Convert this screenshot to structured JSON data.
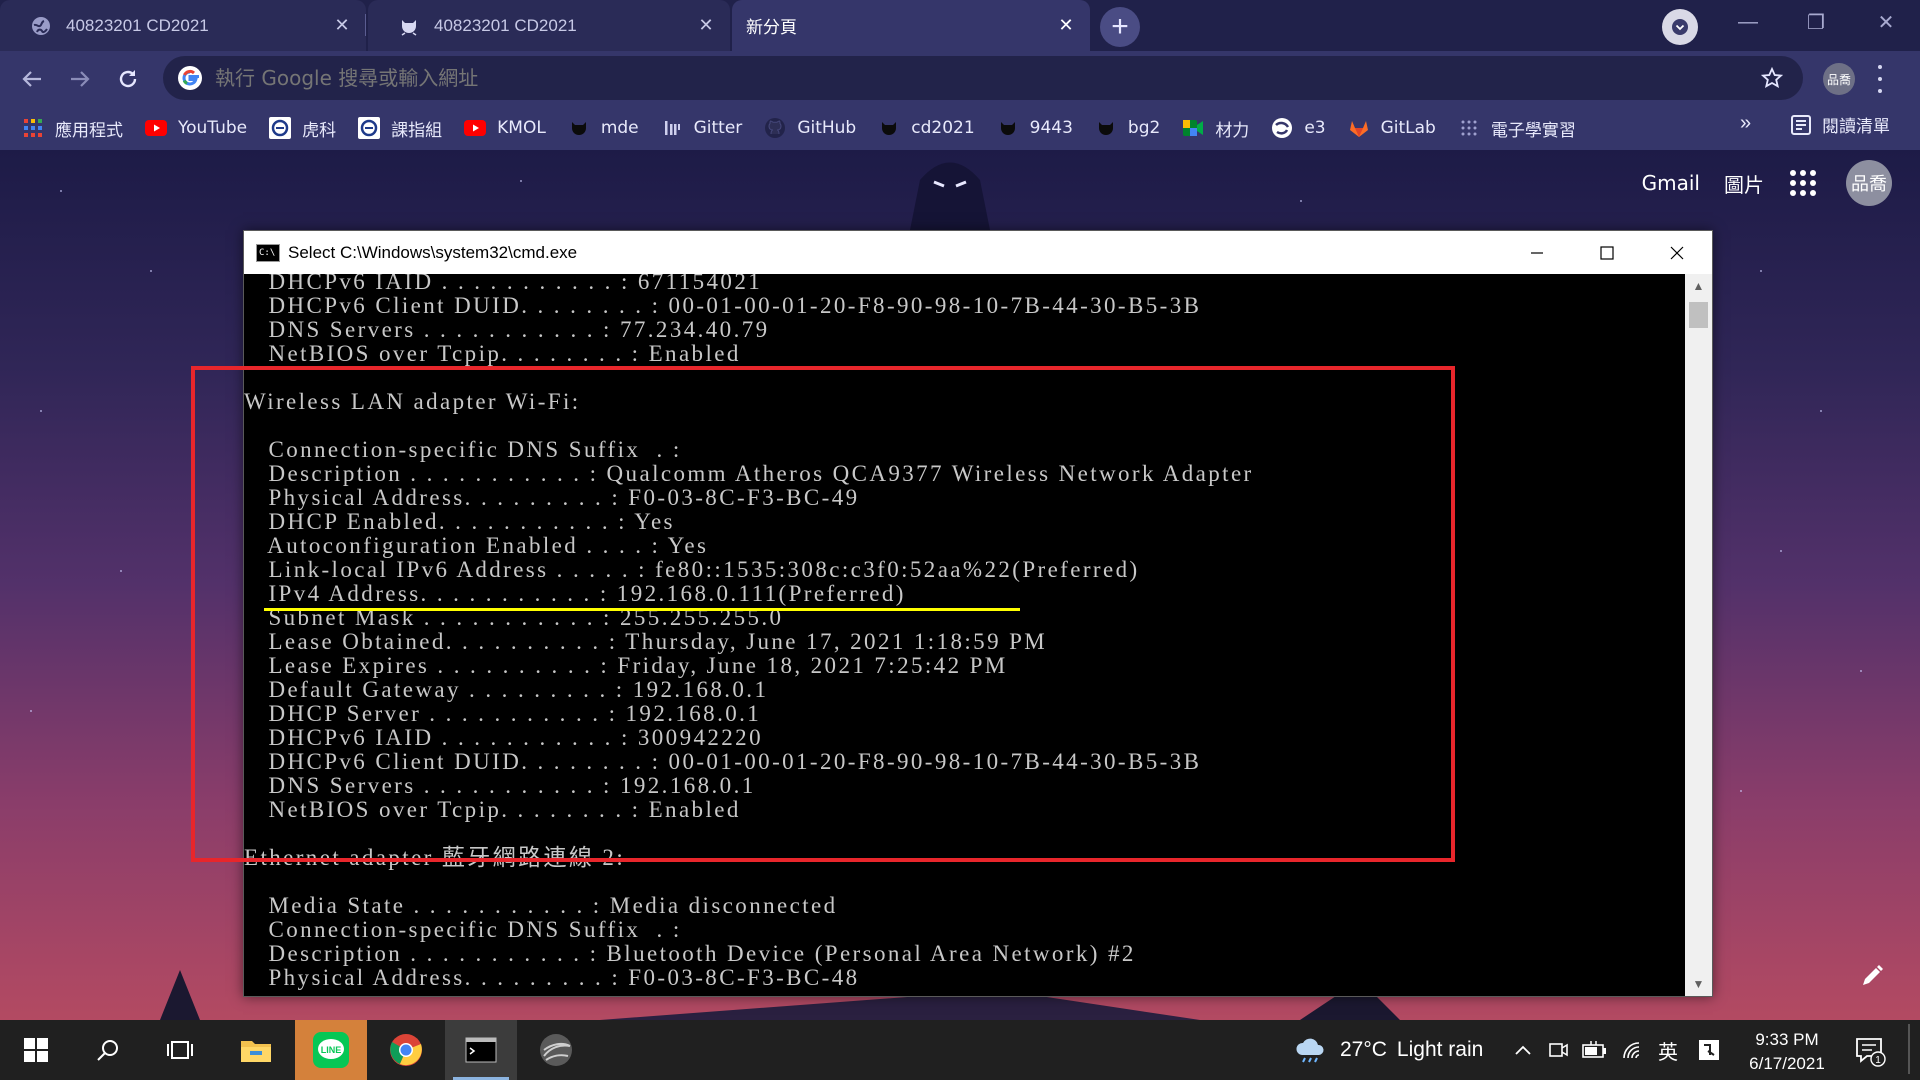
{
  "tabs": [
    {
      "title": "40823201 CD2021",
      "icon": "globe-icon",
      "active": false
    },
    {
      "title": "40823201 CD2021",
      "icon": "github-cat-icon",
      "active": false
    },
    {
      "title": "新分頁",
      "icon": "",
      "active": true
    }
  ],
  "toolbar": {
    "omnibox_placeholder": "執行 Google 搜尋或輸入網址",
    "profile_label": "品喬"
  },
  "bookmarks": [
    {
      "label": "應用程式",
      "icon": "apps-grid-icon"
    },
    {
      "label": "YouTube",
      "icon": "youtube-icon"
    },
    {
      "label": "虎科",
      "icon": "school-logo-icon"
    },
    {
      "label": "課指組",
      "icon": "school-logo-icon"
    },
    {
      "label": "KMOL",
      "icon": "youtube-icon"
    },
    {
      "label": "mde",
      "icon": "github-cat-icon"
    },
    {
      "label": "Gitter",
      "icon": "gitter-icon"
    },
    {
      "label": "GitHub",
      "icon": "github-icon"
    },
    {
      "label": "cd2021",
      "icon": "github-cat-icon"
    },
    {
      "label": "9443",
      "icon": "github-cat-icon"
    },
    {
      "label": "bg2",
      "icon": "github-cat-icon"
    },
    {
      "label": "材力",
      "icon": "meet-icon"
    },
    {
      "label": "e3",
      "icon": "e3-icon"
    },
    {
      "label": "GitLab",
      "icon": "gitlab-icon"
    },
    {
      "label": "電子學實習",
      "icon": "dots-icon"
    }
  ],
  "bookmarks_overflow": "»",
  "reading_list": "閱讀清單",
  "google_bar": {
    "gmail": "Gmail",
    "images": "圖片",
    "avatar": "品喬"
  },
  "cmd": {
    "title": "Select C:\\Windows\\system32\\cmd.exe",
    "lines": [
      "   DHCPv6 IAID . . . . . . . . . . . : 671154021",
      "   DHCPv6 Client DUID. . . . . . . . : 00-01-00-01-20-F8-90-98-10-7B-44-30-B5-3B",
      "   DNS Servers . . . . . . . . . . . : 77.234.40.79",
      "   NetBIOS over Tcpip. . . . . . . . : Enabled",
      "",
      "Wireless LAN adapter Wi-Fi:",
      "",
      "   Connection-specific DNS Suffix  . :",
      "   Description . . . . . . . . . . . : Qualcomm Atheros QCA9377 Wireless Network Adapter",
      "   Physical Address. . . . . . . . . : F0-03-8C-F3-BC-49",
      "   DHCP Enabled. . . . . . . . . . . : Yes",
      "   Autoconfiguration Enabled . . . . : Yes",
      "   Link-local IPv6 Address . . . . . : fe80::1535:308c:c3f0:52aa%22(Preferred)",
      "   IPv4 Address. . . . . . . . . . . : 192.168.0.111(Preferred)",
      "   Subnet Mask . . . . . . . . . . . : 255.255.255.0",
      "   Lease Obtained. . . . . . . . . . : Thursday, June 17, 2021 1:18:59 PM",
      "   Lease Expires . . . . . . . . . . : Friday, June 18, 2021 7:25:42 PM",
      "   Default Gateway . . . . . . . . . : 192.168.0.1",
      "   DHCP Server . . . . . . . . . . . : 192.168.0.1",
      "   DHCPv6 IAID . . . . . . . . . . . : 300942220",
      "   DHCPv6 Client DUID. . . . . . . . : 00-01-00-01-20-F8-90-98-10-7B-44-30-B5-3B",
      "   DNS Servers . . . . . . . . . . . : 192.168.0.1",
      "   NetBIOS over Tcpip. . . . . . . . : Enabled",
      "",
      "Ethernet adapter 藍牙網路連線 2:",
      "",
      "   Media State . . . . . . . . . . . : Media disconnected",
      "   Connection-specific DNS Suffix  . :",
      "   Description . . . . . . . . . . . : Bluetooth Device (Personal Area Network) #2",
      "   Physical Address. . . . . . . . . : F0-03-8C-F3-BC-48"
    ]
  },
  "taskbar": {
    "weather_temp": "27°C",
    "weather_desc": "Light rain",
    "ime": "英",
    "time": "9:33 PM",
    "date": "6/17/2021",
    "notification_count": "1"
  },
  "colors": {
    "annotation_box": "#e8262b",
    "highlight_underline": "#ffff00",
    "tab_strip": "#20214a",
    "toolbar": "#35366a"
  }
}
